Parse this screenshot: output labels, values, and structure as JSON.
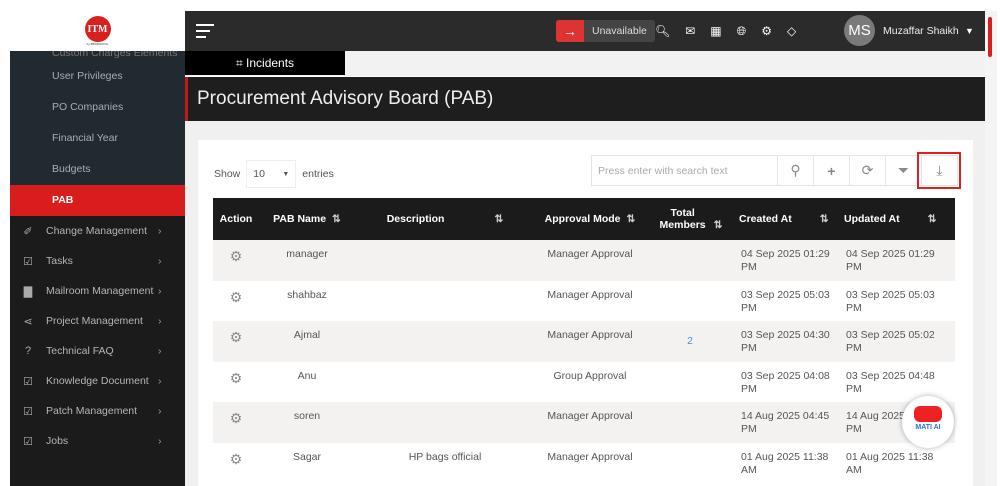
{
  "logo": {
    "text": "ITM",
    "sub": "by BRAINCOOL"
  },
  "sidebar": {
    "cut_item": "Custom Charges Elements",
    "sub_items": [
      {
        "label": "User Privileges"
      },
      {
        "label": "PO Companies"
      },
      {
        "label": "Financial Year"
      },
      {
        "label": "Budgets"
      },
      {
        "label": "PAB",
        "active": true
      }
    ],
    "items": [
      {
        "label": "Change Management",
        "icon": "wand-icon",
        "glyph": "✐"
      },
      {
        "label": "Tasks",
        "icon": "checkbox-icon",
        "glyph": "☑"
      },
      {
        "label": "Mailroom Management",
        "icon": "file-icon",
        "glyph": "▇"
      },
      {
        "label": "Project Management",
        "icon": "share-icon",
        "glyph": "⋖"
      },
      {
        "label": "Technical FAQ",
        "icon": "question-icon",
        "glyph": "?"
      },
      {
        "label": "Knowledge Document",
        "icon": "checkbox-icon",
        "glyph": "☑"
      },
      {
        "label": "Patch Management",
        "icon": "checkbox-icon",
        "glyph": "☑"
      },
      {
        "label": "Jobs",
        "icon": "checkbox-icon",
        "glyph": "☑"
      }
    ]
  },
  "topbar": {
    "status": "Unavailable",
    "avatar": "MS",
    "user": "Muzaffar Shaikh",
    "accent": "#d33333"
  },
  "tabs": [
    {
      "label": "Incidents"
    }
  ],
  "page": {
    "title": "Procurement Advisory Board (PAB)"
  },
  "controls": {
    "show": "Show",
    "entries": "entries",
    "page_size": "10",
    "search_placeholder": "Press enter with search text"
  },
  "table": {
    "headers": [
      "Action",
      "PAB Name",
      "Description",
      "Approval Mode",
      "Total Members",
      "Created At",
      "Updated At"
    ],
    "rows": [
      {
        "name": "manager",
        "desc": "",
        "mode": "Manager Approval",
        "members": "",
        "c1": "04 Sep 2025 01:29",
        "c2": "PM",
        "u1": "04 Sep 2025 01:29",
        "u2": "PM"
      },
      {
        "name": "shahbaz",
        "desc": "",
        "mode": "Manager Approval",
        "members": "",
        "c1": "03 Sep 2025 05:03",
        "c2": "PM",
        "u1": "03 Sep 2025 05:03",
        "u2": "PM"
      },
      {
        "name": "Ajmal",
        "desc": "",
        "mode": "Manager Approval",
        "members": "2",
        "c1": "03 Sep 2025 04:30",
        "c2": "PM",
        "u1": "03 Sep 2025 05:02",
        "u2": "PM"
      },
      {
        "name": "Anu",
        "desc": "",
        "mode": "Group Approval",
        "members": "",
        "c1": "03 Sep 2025 04:08",
        "c2": "PM",
        "u1": "03 Sep 2025 04:48",
        "u2": "PM"
      },
      {
        "name": "soren",
        "desc": "",
        "mode": "Manager Approval",
        "members": "",
        "c1": "14 Aug 2025 04:45",
        "c2": "PM",
        "u1": "14 Aug 2025",
        "u2": "PM"
      },
      {
        "name": "Sagar",
        "desc": "HP bags official",
        "mode": "Manager Approval",
        "members": "",
        "c1": "01 Aug 2025 11:38",
        "c2": "AM",
        "u1": "01 Aug 2025 11:38",
        "u2": "AM"
      }
    ]
  },
  "assistant": {
    "label": "MATI AI"
  }
}
